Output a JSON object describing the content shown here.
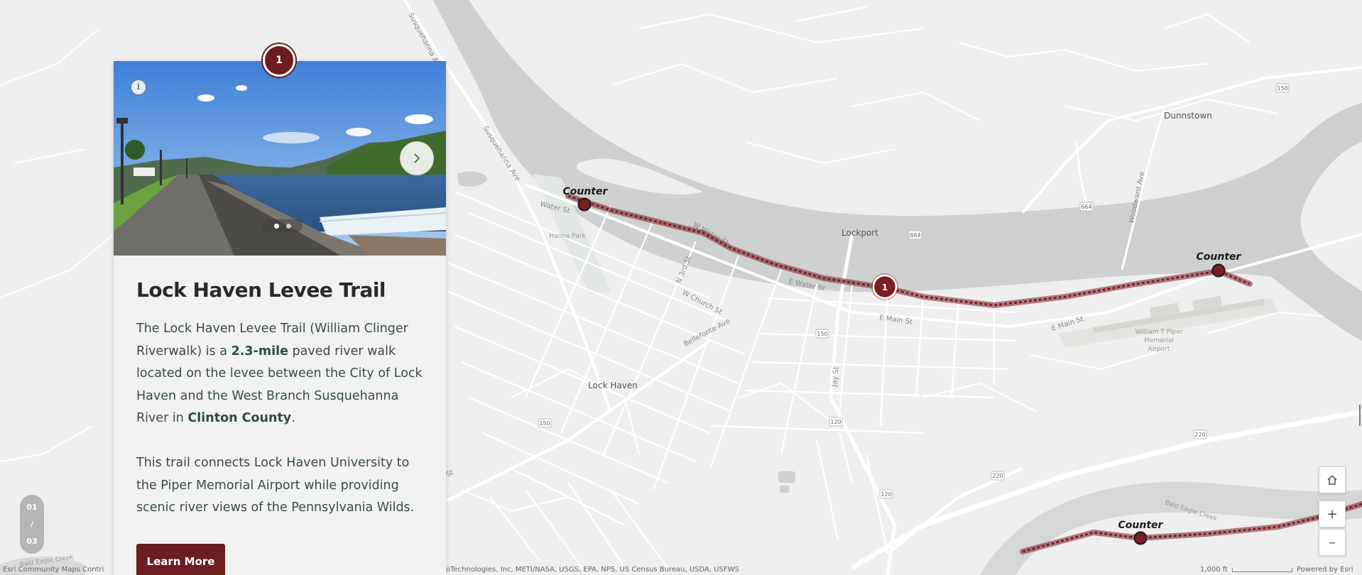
{
  "map": {
    "places": {
      "dunnstown": "Dunnstown",
      "lockport": "Lockport",
      "lock_haven": "Lock Haven",
      "hanna_park": "Hanna Park",
      "airport_line1": "William T Piper",
      "airport_line2": "Memorial",
      "airport_line3": "Airport"
    },
    "streets": {
      "susquehanna_ave_top": "Susquehanna Ave",
      "susquehanna_ave": "Susquehanna Ave",
      "water_st": "Water St",
      "w_water_st": "W Water St",
      "e_water_st": "E Water St",
      "n_3rd_st": "N 3rd St",
      "w_church_st": "W Church St",
      "e_main_st": "E Main St",
      "e_main_st_east": "E Main St",
      "bellefonte_ave": "Bellefonte Ave",
      "jay_st": "Jay St",
      "woodward_ave": "Woodward Ave",
      "bald_eagle_creek": "Bald Eagle Creek",
      "bald_eagle_creek_left": "Bald Eagle Creek",
      "st_fragment": "St"
    },
    "shields": {
      "r150_top": "150",
      "r664_left": "664",
      "r664_right": "664",
      "r150_mid": "150",
      "r150_left": "150",
      "r120_a": "120",
      "r120_b": "120",
      "r220_a": "220",
      "r220_b": "220"
    },
    "counters": {
      "c1": "Counter",
      "c2": "Counter",
      "c3": "Counter"
    },
    "trail_marker": "1",
    "colors": {
      "trail": "#7a1e22",
      "river": "#cfd0d0",
      "land": "#efefef",
      "road": "#ffffff"
    }
  },
  "card": {
    "step_number": "1",
    "info_icon": "i",
    "title": "Lock Haven Levee Trail",
    "p1_a": "The Lock Haven Levee Trail (William Clinger Riverwalk) is a ",
    "p1_b": "2.3-mile",
    "p1_c": " paved river walk located on the levee between the City of Lock Haven and the West Branch Susquehanna River in ",
    "p1_d": "Clinton County",
    "p1_e": ".",
    "p2": "This trail connects Lock Haven University to the Piper Memorial Airport while providing scenic river views of the Pennsylvania Wilds.",
    "button_label": "Learn More",
    "slides_total": 2,
    "slide_active": 1
  },
  "pager": {
    "current": "01",
    "separator": "/",
    "total": "03"
  },
  "controls": {
    "home_icon": "home-icon",
    "zoom_in": "+",
    "zoom_out": "–"
  },
  "attribution": {
    "left": "Esri Community Maps Contri",
    "middle": "oTechnologies, Inc, METI/NASA, USGS, EPA, NPS, US Census Bureau, USDA, USFWS",
    "scale": "1,000 ft",
    "right": "Powered by Esri"
  }
}
